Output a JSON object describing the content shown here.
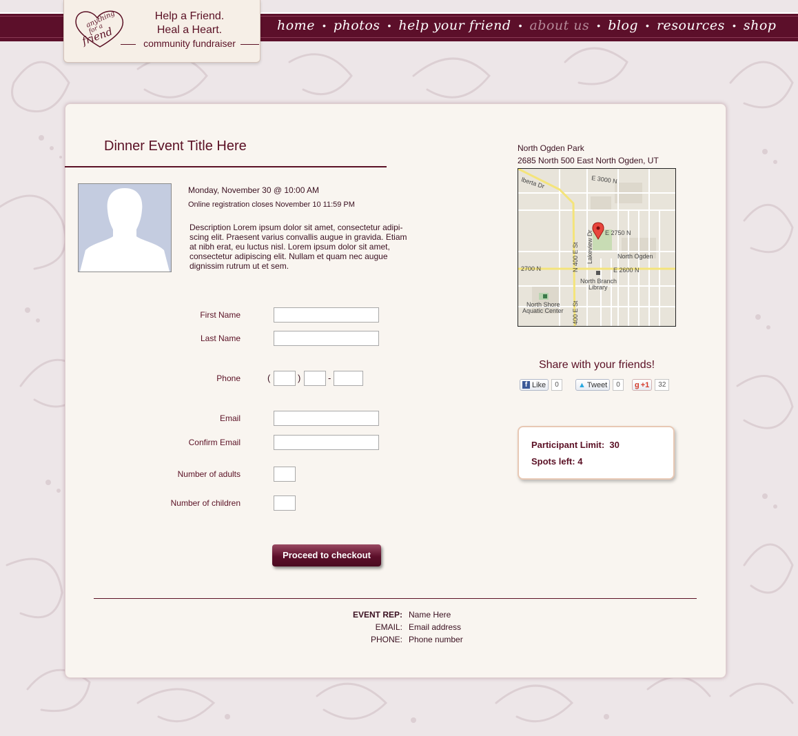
{
  "logo": {
    "mark_text": "anything for a friend",
    "line1": "Help a Friend.",
    "line2": "Heal a Heart.",
    "line3": "community fundraiser"
  },
  "nav": {
    "items": [
      {
        "label": "home",
        "active": false
      },
      {
        "label": "photos",
        "active": false
      },
      {
        "label": "help your friend",
        "active": false
      },
      {
        "label": "about us",
        "active": true
      },
      {
        "label": "blog",
        "active": false
      },
      {
        "label": "resources",
        "active": false
      },
      {
        "label": "shop",
        "active": false
      }
    ],
    "separator": "•"
  },
  "event": {
    "title": "Dinner Event Title Here",
    "date": "Monday, November 30 @ 10:00 AM",
    "closes": "Online registration closes November 10 11:59 PM",
    "description": "Description Lorem ipsum dolor sit amet, consectetur adipi-scing elit. Praesent varius convallis augue in gravida. Etiam at nibh erat, eu luctus nisl. Lorem ipsum dolor sit amet, consectetur adipiscing elit. Nullam et quam nec augue dignissim rutrum ut et sem."
  },
  "form": {
    "first_name_label": "First Name",
    "last_name_label": "Last Name",
    "phone_label": "Phone",
    "phone_open": "(",
    "phone_close": ")",
    "phone_dash": "-",
    "email_label": "Email",
    "confirm_email_label": "Confirm Email",
    "adults_label": "Number of adults",
    "children_label": "Number of children",
    "first_name_value": "",
    "last_name_value": "",
    "email_value": "",
    "confirm_email_value": "",
    "adults_value": "",
    "children_value": "",
    "checkout_label": "Proceed to checkout"
  },
  "rep": {
    "rep_label": "EVENT REP:",
    "rep_value": "Name Here",
    "email_label": "EMAIL:",
    "email_value": "Email address",
    "phone_label": "PHONE:",
    "phone_value": "Phone number"
  },
  "location": {
    "name": "North Ogden Park",
    "address": "2685 North 500 East North Ogden, UT",
    "map_labels": {
      "berta": "lberta Dr",
      "e3000": "E 3000 N",
      "e2750": "E 2750 N",
      "n400": "N 400 E St",
      "lakeview": "Lakeview Dr",
      "north_ogden": "North Ogden",
      "w2700": "2700 N",
      "e2600": "E 2600 N",
      "library1": "North Branch",
      "library2": "Library",
      "aquatic1": "North Shore",
      "aquatic2": "Aquatic Center",
      "s400": "400 E St"
    }
  },
  "share": {
    "title": "Share with your friends!",
    "like_label": "Like",
    "like_count": "0",
    "tweet_label": "Tweet",
    "tweet_count": "0",
    "plus_label": "+1",
    "plus_count": "32"
  },
  "limits": {
    "limit_label": "Participant Limit:",
    "limit_value": "30",
    "spots_label": "Spots left:",
    "spots_value": "4"
  },
  "colors": {
    "brand": "#5c0f2a",
    "panel": "#f9f5f0",
    "background": "#ede6e8"
  }
}
